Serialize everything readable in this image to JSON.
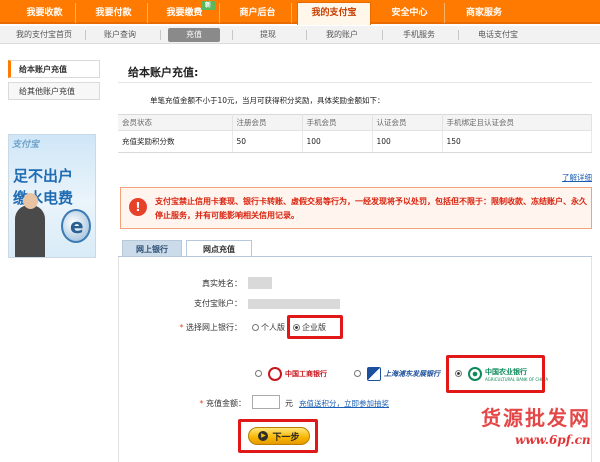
{
  "top_nav": {
    "tabs": [
      "我要收款",
      "我要付款",
      "我要缴费",
      "商户后台",
      "我的支付宝",
      "安全中心",
      "商家服务"
    ],
    "new_badge": "新"
  },
  "sub_nav": {
    "items": [
      "我的支付宝首页",
      "账户查询",
      "充值",
      "提现",
      "我的账户",
      "手机服务",
      "电话支付宝"
    ]
  },
  "sidebar": {
    "items": [
      "给本账户充值",
      "给其他账户充值"
    ]
  },
  "ad": {
    "brand": "支付宝",
    "line1": "足不出户",
    "line2": "缴水电费",
    "symbol": "e"
  },
  "main": {
    "title": "给本账户充值:",
    "description": "单笔充值金额不小于10元，当月可获得积分奖励，具体奖励金额如下：",
    "reward_table": {
      "headers": [
        "会员状态",
        "注册会员",
        "手机会员",
        "认证会员",
        "手机绑定且认证会员"
      ],
      "rows": [
        [
          "充值奖励积分数",
          "50",
          "100",
          "100",
          "150"
        ]
      ]
    },
    "more_link": "了解详细",
    "warning_icon": "!",
    "warning": "支付宝禁止信用卡套现、银行卡转账、虚假交易等行为，一经发现将予以处罚，包括但不限于：限制收款、冻结账户、永久停止服务，并有可能影响相关信用记录。"
  },
  "tabs": [
    "网上银行",
    "网点充值"
  ],
  "form": {
    "name_label": "真实姓名：",
    "account_label": "支付宝账户：",
    "bank_select_label": "选择网上银行：",
    "required_mark": "*",
    "option_personal": "个人版",
    "option_enterprise": "企业版",
    "banks": [
      {
        "name": "中国工商银行"
      },
      {
        "name": "上海浦东发展银行"
      },
      {
        "name": "中国农业银行",
        "english": "AGRICULTURAL BANK OF CHINA"
      }
    ],
    "amount_label": "充值金额：",
    "amount_unit": "元",
    "amount_link": "充值送积分，立即参加抽奖",
    "next_button": "下一步",
    "next_arrow": "▶"
  },
  "watermark": {
    "cn": "货源批发网",
    "url": "www.6pf.cn"
  },
  "colors": {
    "nav_orange": "#ff7a00",
    "highlight_red": "#e01818",
    "warning_red": "#d9230f",
    "link_blue": "#1a5fb4"
  }
}
